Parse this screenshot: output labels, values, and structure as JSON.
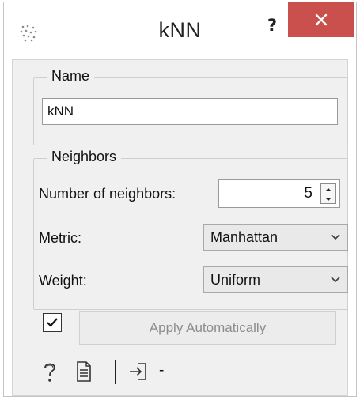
{
  "window": {
    "title": "kNN",
    "help_glyph": "?",
    "app_icon": "knn-dots-icon",
    "close_icon": "close-icon",
    "colors": {
      "close_button": "#c9504c",
      "panel_bg": "#f0f0f0"
    }
  },
  "name_group": {
    "legend": "Name",
    "value": "kNN"
  },
  "neighbors_group": {
    "legend": "Neighbors",
    "count_label": "Number of neighbors:",
    "count_value": "5",
    "metric_label": "Metric:",
    "metric_value": "Manhattan",
    "weight_label": "Weight:",
    "weight_value": "Uniform"
  },
  "apply": {
    "checked": true,
    "label": "Apply Automatically"
  },
  "status_bar": {
    "icons": [
      "help-icon",
      "report-icon",
      "input-icon"
    ],
    "input_summary": "-"
  }
}
